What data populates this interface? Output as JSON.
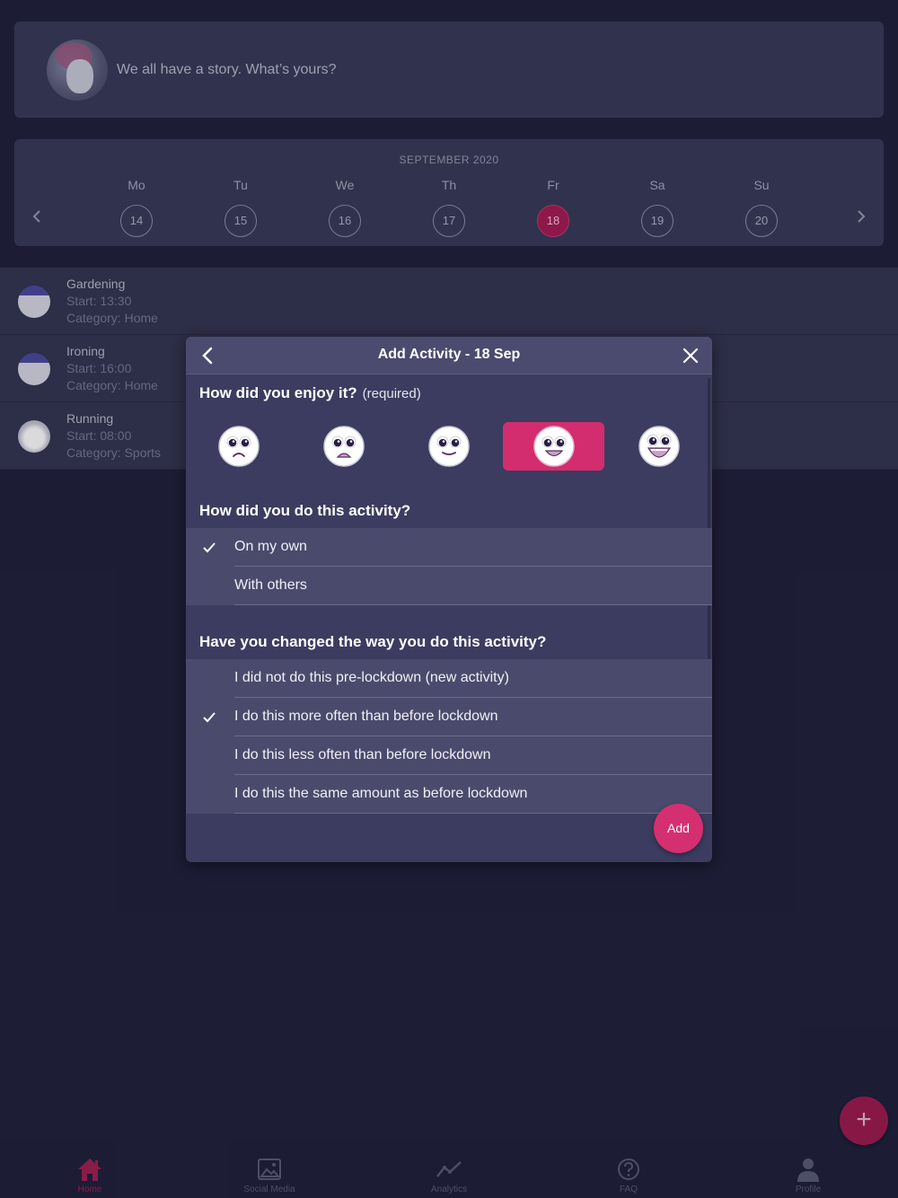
{
  "story": {
    "prompt": "We all have a story. What’s yours?"
  },
  "calendar": {
    "month": "SEPTEMBER 2020",
    "prev_icon": "chevron-left-icon",
    "next_icon": "chevron-right-icon",
    "days": [
      {
        "name": "Mo",
        "num": "14"
      },
      {
        "name": "Tu",
        "num": "15"
      },
      {
        "name": "We",
        "num": "16"
      },
      {
        "name": "Th",
        "num": "17"
      },
      {
        "name": "Fr",
        "num": "18",
        "selected": true
      },
      {
        "name": "Sa",
        "num": "19"
      },
      {
        "name": "Su",
        "num": "20"
      }
    ]
  },
  "activities": [
    {
      "name": "Gardening",
      "start": "Start: 13:30",
      "category": "Category: Home"
    },
    {
      "name": "Ironing",
      "start": "Start: 16:00",
      "category": "Category: Home"
    },
    {
      "name": "Running",
      "start": "Start: 08:00",
      "category": "Category: Sports"
    }
  ],
  "modal": {
    "title": "Add Activity - 18 Sep",
    "q1": {
      "title": "How did you enjoy it?",
      "required": "(required)"
    },
    "enjoyment": {
      "options": [
        "very-sad-face-icon",
        "sad-face-icon",
        "neutral-face-icon",
        "happy-face-icon",
        "very-happy-face-icon"
      ],
      "selected_index": 3
    },
    "q2": {
      "title": "How did you do this activity?"
    },
    "how_options": [
      {
        "label": "On my own",
        "checked": true
      },
      {
        "label": "With others",
        "checked": false
      }
    ],
    "q3": {
      "title": "Have you changed the way you do this activity?"
    },
    "change_options": [
      {
        "label": "I did not do this pre-lockdown (new activity)",
        "checked": false
      },
      {
        "label": "I do this more often than before lockdown",
        "checked": true
      },
      {
        "label": "I do this less often than before lockdown",
        "checked": false
      },
      {
        "label": "I do this the same amount as before lockdown",
        "checked": false
      }
    ],
    "add_label": "Add"
  },
  "nav": {
    "items": [
      {
        "label": "Home",
        "icon": "home-icon",
        "active": true
      },
      {
        "label": "Social Media",
        "icon": "image-icon"
      },
      {
        "label": "Analytics",
        "icon": "analytics-icon"
      },
      {
        "label": "FAQ",
        "icon": "help-icon"
      },
      {
        "label": "Profile",
        "icon": "profile-icon"
      }
    ]
  },
  "fab": {
    "icon": "plus-icon",
    "label": "+"
  },
  "colors": {
    "accent": "#d42f71",
    "background": "#20223a",
    "card": "#393b57"
  }
}
